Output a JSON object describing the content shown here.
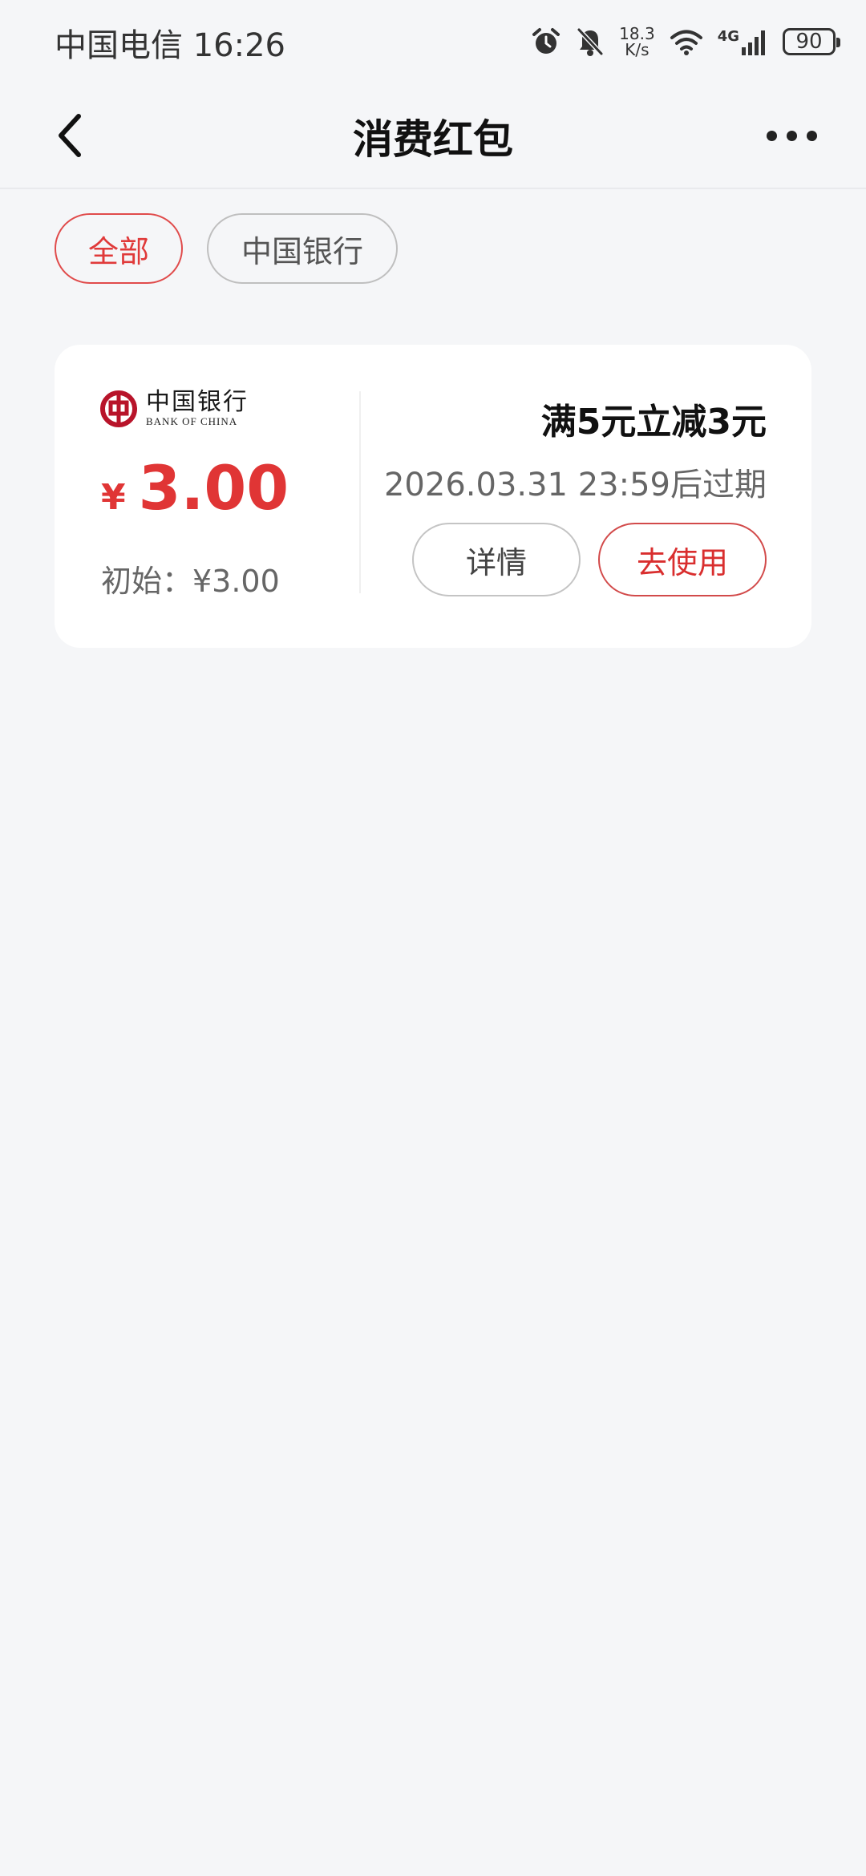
{
  "status_bar": {
    "carrier_time": "中国电信 16:26",
    "speed_value": "18.3",
    "speed_unit": "K/s",
    "network": "4G",
    "battery": "90",
    "icons": [
      "alarm-icon",
      "mute-bell-icon",
      "wifi-icon",
      "signal-icon",
      "battery-icon"
    ]
  },
  "nav": {
    "title": "消费红包",
    "back_icon": "chevron-left-icon",
    "more_icon": "more-dots-icon"
  },
  "filters": [
    {
      "label": "全部",
      "active": true
    },
    {
      "label": "中国银行",
      "active": false
    }
  ],
  "coupon": {
    "bank_name_cn": "中国银行",
    "bank_name_en": "BANK OF CHINA",
    "currency_symbol": "¥",
    "amount": "3.00",
    "initial_label": "初始：¥3.00",
    "condition": "满5元立减3元",
    "expiry": "2026.03.31 23:59后过期",
    "detail_button": "详情",
    "use_button": "去使用"
  },
  "colors": {
    "accent_red": "#e03535",
    "background": "#f5f6f8",
    "card": "#ffffff"
  }
}
